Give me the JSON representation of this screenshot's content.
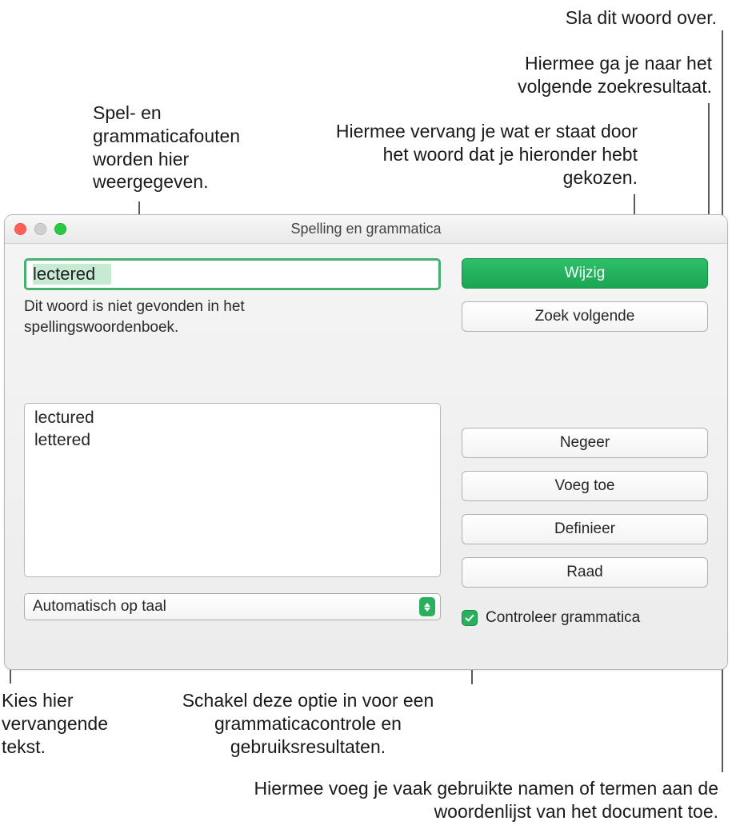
{
  "window": {
    "title": "Spelling en grammatica",
    "misspelled_word": "lectered",
    "not_found_msg": "Dit woord is niet gevonden in het spellingswoordenboek.",
    "suggestions": [
      "lectured",
      "lettered"
    ],
    "language_selector": "Automatisch op taal",
    "check_grammar_label": "Controleer grammatica"
  },
  "buttons": {
    "change": "Wijzig",
    "find_next": "Zoek volgende",
    "ignore": "Negeer",
    "add": "Voeg toe",
    "define": "Definieer",
    "guess": "Raad"
  },
  "callouts": {
    "top_left": "Spel- en grammaticafouten worden hier weergegeven.",
    "skip": "Sla dit woord over.",
    "next": "Hiermee ga je naar het volgende zoekresultaat.",
    "replace": "Hiermee vervang je wat er staat door het woord dat je hieronder hebt gekozen.",
    "choose_replacement": "Kies hier vervangende tekst.",
    "grammar_toggle": "Schakel deze optie in voor een grammaticacontrole en gebruiksresultaten.",
    "add_term": "Hiermee voeg je vaak gebruikte namen of termen aan de woordenlijst van het document toe."
  }
}
